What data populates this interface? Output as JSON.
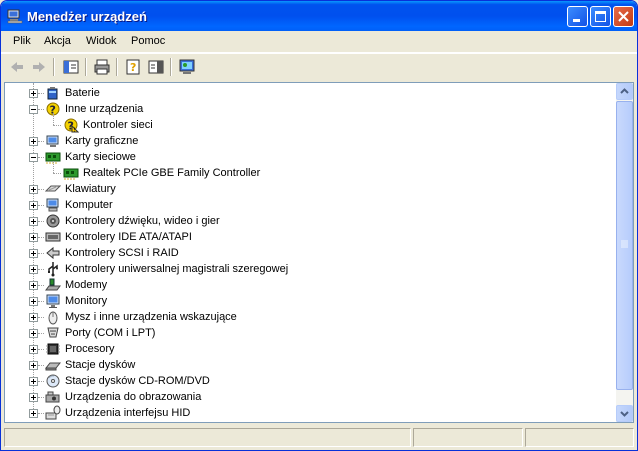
{
  "window": {
    "title": "Menedżer urządzeń"
  },
  "menu": [
    "Plik",
    "Akcja",
    "Widok",
    "Pomoc"
  ],
  "toolbar": {
    "buttons": [
      "back-icon",
      "forward-icon",
      "show-hide-tree-icon",
      "print-icon",
      "properties-icon",
      "help-icon",
      "scan-hardware-icon"
    ]
  },
  "tree": {
    "items": [
      {
        "label": "Baterie",
        "icon": "battery-icon",
        "level": 1,
        "state": "collapsed"
      },
      {
        "label": "Inne urządzenia",
        "icon": "unknown-device-icon",
        "level": 1,
        "state": "expanded"
      },
      {
        "label": "Kontroler sieci",
        "icon": "warning-device-icon",
        "level": 2,
        "state": "leaf"
      },
      {
        "label": "Karty graficzne",
        "icon": "display-adapter-icon",
        "level": 1,
        "state": "collapsed"
      },
      {
        "label": "Karty sieciowe",
        "icon": "network-card-icon",
        "level": 1,
        "state": "expanded"
      },
      {
        "label": "Realtek PCIe GBE Family Controller",
        "icon": "network-card-icon",
        "level": 2,
        "state": "leaf"
      },
      {
        "label": "Klawiatury",
        "icon": "keyboard-icon",
        "level": 1,
        "state": "collapsed"
      },
      {
        "label": "Komputer",
        "icon": "computer-icon",
        "level": 1,
        "state": "collapsed"
      },
      {
        "label": "Kontrolery dźwięku, wideo i gier",
        "icon": "sound-icon",
        "level": 1,
        "state": "collapsed"
      },
      {
        "label": "Kontrolery IDE ATA/ATAPI",
        "icon": "ide-controller-icon",
        "level": 1,
        "state": "collapsed"
      },
      {
        "label": "Kontrolery SCSI i RAID",
        "icon": "scsi-icon",
        "level": 1,
        "state": "collapsed"
      },
      {
        "label": "Kontrolery uniwersalnej magistrali szeregowej",
        "icon": "usb-icon",
        "level": 1,
        "state": "collapsed"
      },
      {
        "label": "Modemy",
        "icon": "modem-icon",
        "level": 1,
        "state": "collapsed"
      },
      {
        "label": "Monitory",
        "icon": "monitor-icon",
        "level": 1,
        "state": "collapsed"
      },
      {
        "label": "Mysz i inne urządzenia wskazujące",
        "icon": "mouse-icon",
        "level": 1,
        "state": "collapsed"
      },
      {
        "label": "Porty (COM i LPT)",
        "icon": "port-icon",
        "level": 1,
        "state": "collapsed"
      },
      {
        "label": "Procesory",
        "icon": "processor-icon",
        "level": 1,
        "state": "collapsed"
      },
      {
        "label": "Stacje dysków",
        "icon": "disk-drive-icon",
        "level": 1,
        "state": "collapsed"
      },
      {
        "label": "Stacje dysków CD-ROM/DVD",
        "icon": "cdrom-icon",
        "level": 1,
        "state": "collapsed"
      },
      {
        "label": "Urządzenia do obrazowania",
        "icon": "imaging-icon",
        "level": 1,
        "state": "collapsed"
      },
      {
        "label": "Urządzenia interfejsu HID",
        "icon": "hid-icon",
        "level": 1,
        "state": "collapsed"
      }
    ]
  },
  "colors": {
    "titlebar": "#0054E3",
    "window_bg": "#ECE9D8",
    "tree_bg": "#FFFFFF",
    "scrollbar": "#C1D3FB"
  }
}
